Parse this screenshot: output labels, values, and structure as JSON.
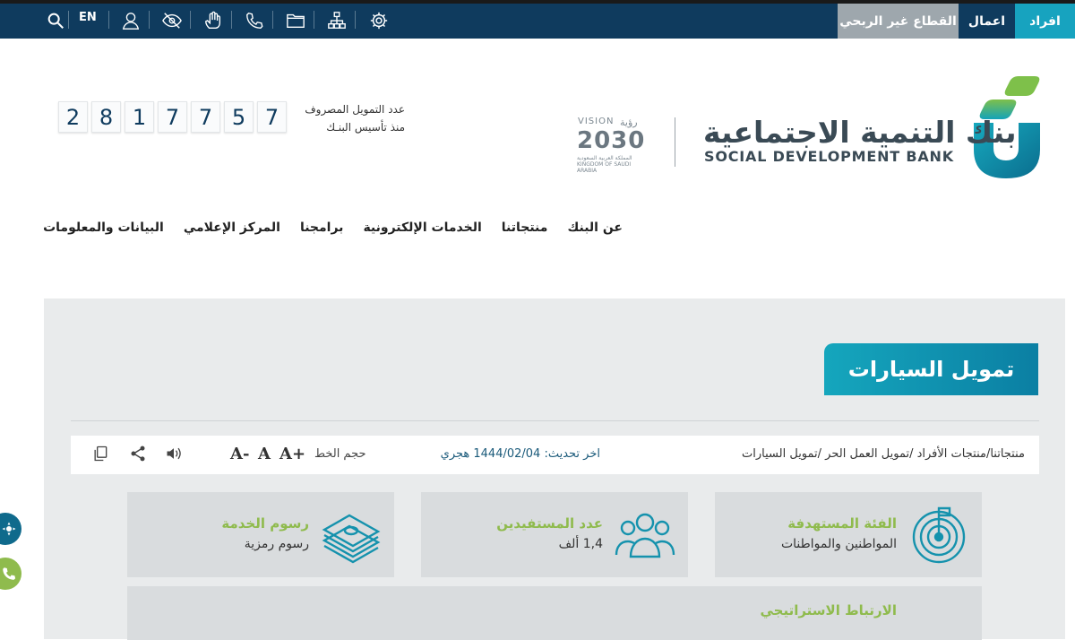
{
  "topbar": {
    "segments": {
      "individuals": "افراد",
      "business": "اعمال",
      "non_profit": "القطاع غير الربحي"
    },
    "language": "EN",
    "icons": [
      "settings-gear-icon",
      "sitemap-icon",
      "folder-icon",
      "phone-icon",
      "sign-language-icon",
      "eye-slash-icon",
      "user-icon",
      "search-icon"
    ]
  },
  "brand": {
    "name_ar": "بنك التنمية الاجتماعية",
    "name_en": "SOCIAL DEVELOPMENT BANK",
    "vision": {
      "label": "VISION",
      "label_ar": "رؤية",
      "year": "2030",
      "sub": "المملكة العربية السعودية KINGDOM OF SAUDI ARABIA"
    }
  },
  "counter": {
    "label_line1": "عدد التمويل المصروف",
    "label_line2": "منذ تأسيس البنـك",
    "digits": [
      "2",
      "8",
      "1",
      "7",
      "7",
      "5",
      "7"
    ]
  },
  "nav": {
    "items": [
      "عن البنك",
      "منتجاتنا",
      "الخدمات الإلكترونية",
      "برامجنا",
      "المركز الإعلامي",
      "البيانات والمعلومات"
    ]
  },
  "page": {
    "title": "تمويل السيارات",
    "breadcrumb": "منتجاتنا/منتجات الأفراد /تمويل العمل الحر /تمويل السيارات",
    "updated": "اخر تحديث: 1444/02/04 هجري",
    "font_size_label": "حجم الخط",
    "font_buttons": {
      "increase": "A+",
      "normal": "A",
      "decrease": "A-"
    },
    "tool_icons": [
      "speaker-icon",
      "share-icon",
      "copy-icon"
    ]
  },
  "cards": [
    {
      "title": "الفئة المستهدفة",
      "value": "المواطنين والمواطنات",
      "icon": "target-icon"
    },
    {
      "title": "عدد المستفيدين",
      "value": "1,4 ألف",
      "icon": "group-icon"
    },
    {
      "title": "رسوم الخدمة",
      "value": "رسوم رمزية",
      "icon": "money-stack-icon"
    }
  ],
  "strategic": {
    "title": "الارتباط الاستراتيجي"
  },
  "floating": [
    "settings-float-icon",
    "phone-float-icon"
  ],
  "colors": {
    "navy": "#0f3b5e",
    "teal": "#17a3bf",
    "green": "#8fbb4d",
    "gray_panel": "#e9ebec"
  }
}
